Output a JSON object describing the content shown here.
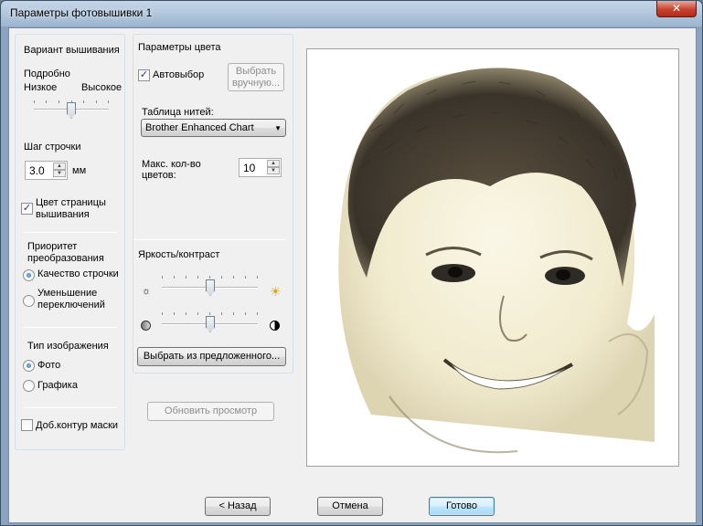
{
  "window": {
    "title": "Параметры фотовышивки 1",
    "close_label": "✕"
  },
  "variant": {
    "group_title": "Вариант вышивания",
    "detail_label": "Подробно",
    "low_label": "Низкое",
    "high_label": "Высокое",
    "detail_level": 0.5,
    "step_label": "Шаг строчки",
    "step_value": "3.0",
    "step_unit": "мм",
    "page_color_label": "Цвет страницы вышивания",
    "page_color_checked": true,
    "priority_label": "Приоритет преобразования",
    "priority_options": [
      "Качество строчки",
      "Уменьшение переключений"
    ],
    "priority_selected": 0,
    "image_type_label": "Тип изображения",
    "image_type_options": [
      "Фото",
      "Графика"
    ],
    "image_type_selected": 0,
    "mask_label": "Доб.контур маски",
    "mask_checked": false
  },
  "color": {
    "group_title": "Параметры цвета",
    "auto_label": "Автовыбор",
    "auto_checked": true,
    "manual_button": "Выбрать вручную...",
    "thread_table_label": "Таблица нитей:",
    "thread_table_value": "Brother Enhanced Chart",
    "max_colors_label": "Макс. кол-во цветов:",
    "max_colors_value": "10",
    "brightness_title": "Яркость/контраст",
    "brightness_level": 0.5,
    "contrast_level": 0.5,
    "choose_button": "Выбрать из предложенного...",
    "refresh_button": "Обновить просмотр"
  },
  "footer": {
    "back": "< Назад",
    "cancel": "Отмена",
    "done": "Готово"
  },
  "colors": {
    "accent": "#3c7fb1",
    "window_frame": "#8aa3bf"
  }
}
